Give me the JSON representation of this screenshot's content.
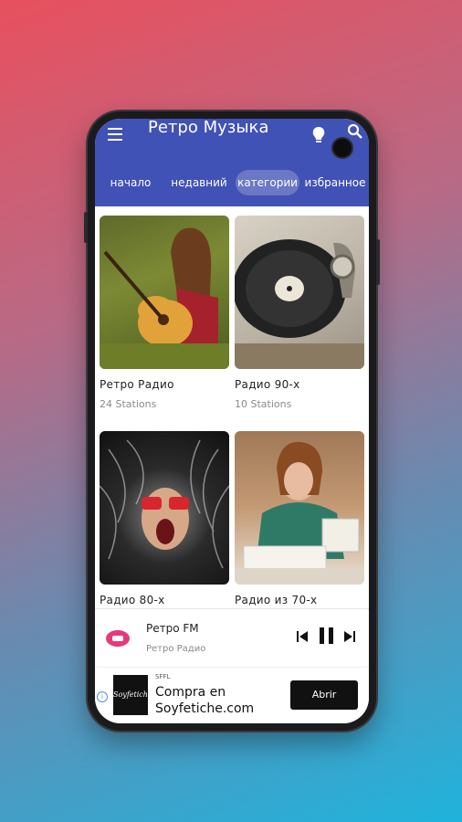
{
  "app": {
    "title": "Ретро Музыка"
  },
  "tabs": [
    {
      "label": "начало",
      "active": false
    },
    {
      "label": "недавний",
      "active": false
    },
    {
      "label": "категории",
      "active": true
    },
    {
      "label": "избранное",
      "active": false
    }
  ],
  "categories": [
    {
      "title": "Ретро Радио",
      "count": "24 Stations"
    },
    {
      "title": "Радио 90-х",
      "count": "10 Stations"
    },
    {
      "title": "Радио 80-х",
      "count": ""
    },
    {
      "title": "Радио из 70-х",
      "count": ""
    }
  ],
  "player": {
    "station": "Ретро FM",
    "category": "Ретро Радио",
    "state": "playing"
  },
  "ad": {
    "brand": "Soyfetiche",
    "tag": "SFFL",
    "headline_1": "Compra en",
    "headline_2": "Soyfetiche.com",
    "cta": "Abrir"
  },
  "colors": {
    "appbar": "#4052b5",
    "accent": "#e8505e"
  }
}
